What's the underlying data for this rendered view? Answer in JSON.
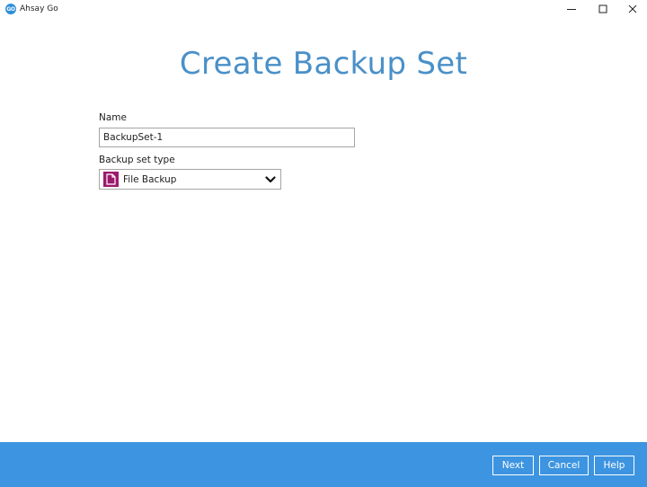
{
  "window": {
    "app_logo_text": "GO",
    "app_title": "Ahsay Go"
  },
  "page": {
    "title": "Create Backup Set"
  },
  "form": {
    "name_label": "Name",
    "name_value": "BackupSet-1",
    "type_label": "Backup set type",
    "type_selected": "File Backup"
  },
  "footer": {
    "next_label": "Next",
    "cancel_label": "Cancel",
    "help_label": "Help"
  },
  "icons": {
    "logo": "ahsay-go-logo-icon",
    "minimize": "minimize-icon",
    "maximize": "maximize-icon",
    "close": "close-icon",
    "file": "file-icon",
    "dropdown": "chevron-down-icon"
  },
  "colors": {
    "title_blue": "#4a90c8",
    "footer_blue": "#3d94e0",
    "file_icon_bg": "#9c1a6d",
    "logo_blue": "#2e8fd8"
  }
}
